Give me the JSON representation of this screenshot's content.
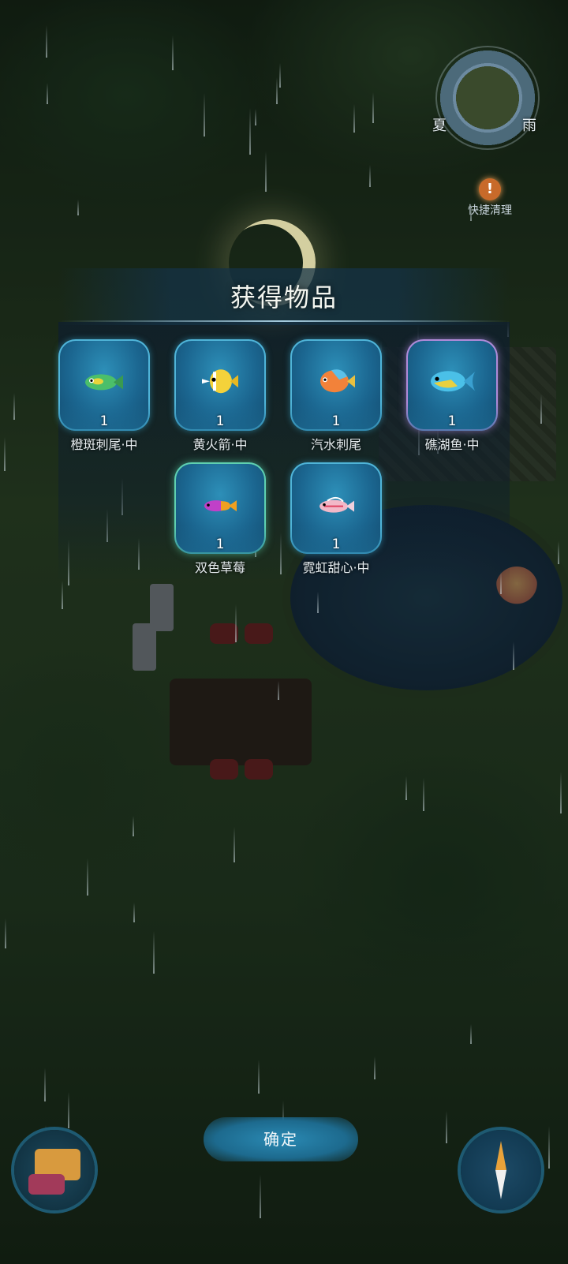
{
  "hud": {
    "season_left": "夏",
    "season_right": "雨",
    "quick_clean_icon": "!",
    "quick_clean_label": "快捷清理"
  },
  "dialog": {
    "title": "获得物品",
    "items": [
      {
        "name": "橙斑刺尾·中",
        "count": "1",
        "icon": "fish-icon",
        "colors": [
          "#4bbf6a",
          "#e8d43a"
        ]
      },
      {
        "name": "黄火箭·中",
        "count": "1",
        "icon": "fish-icon",
        "colors": [
          "#f4d23a",
          "#ffffff"
        ]
      },
      {
        "name": "汽水刺尾",
        "count": "1",
        "icon": "fish-icon",
        "colors": [
          "#f2823a",
          "#5cc0e8"
        ]
      },
      {
        "name": "礁湖鱼·中",
        "count": "1",
        "icon": "fish-icon",
        "colors": [
          "#4ac0e8",
          "#e8d040"
        ]
      },
      {
        "name": "双色草莓",
        "count": "1",
        "icon": "fish-icon",
        "colors": [
          "#c040c8",
          "#f0a020"
        ]
      },
      {
        "name": "霓虹甜心·中",
        "count": "1",
        "icon": "fish-icon",
        "colors": [
          "#f2b8c8",
          "#ffffff"
        ]
      }
    ],
    "confirm_label": "确定"
  },
  "bottom": {
    "chat_icon": "chat-icon",
    "compass_icon": "compass-icon"
  }
}
